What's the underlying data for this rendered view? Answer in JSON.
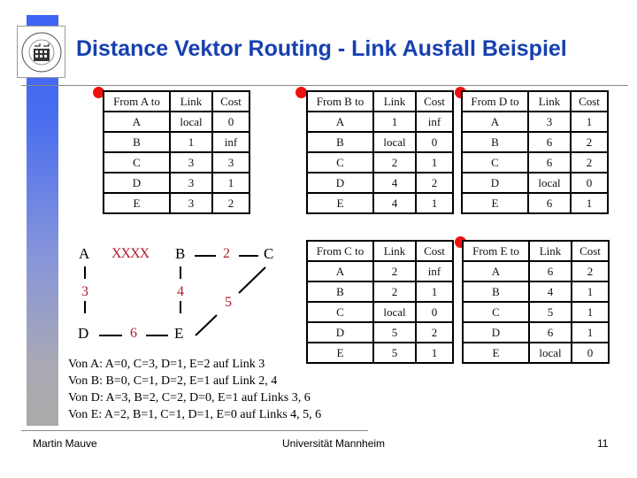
{
  "slide": {
    "title": "Distance Vektor Routing - Link Ausfall Beispiel",
    "logo": "university-seal-icon",
    "accent_color": "#1740b0",
    "bullet_color": "#ee1010",
    "label_color": "#b01c2e"
  },
  "tables": {
    "A": {
      "headers": [
        "From A to",
        "Link",
        "Cost"
      ],
      "rows": [
        [
          "A",
          "local",
          "0"
        ],
        [
          "B",
          "1",
          "inf"
        ],
        [
          "C",
          "3",
          "3"
        ],
        [
          "D",
          "3",
          "1"
        ],
        [
          "E",
          "3",
          "2"
        ]
      ]
    },
    "B": {
      "headers": [
        "From B to",
        "Link",
        "Cost"
      ],
      "rows": [
        [
          "A",
          "1",
          "inf"
        ],
        [
          "B",
          "local",
          "0"
        ],
        [
          "C",
          "2",
          "1"
        ],
        [
          "D",
          "4",
          "2"
        ],
        [
          "E",
          "4",
          "1"
        ]
      ]
    },
    "D": {
      "headers": [
        "From D to",
        "Link",
        "Cost"
      ],
      "rows": [
        [
          "A",
          "3",
          "1"
        ],
        [
          "B",
          "6",
          "2"
        ],
        [
          "C",
          "6",
          "2"
        ],
        [
          "D",
          "local",
          "0"
        ],
        [
          "E",
          "6",
          "1"
        ]
      ]
    },
    "C": {
      "headers": [
        "From C to",
        "Link",
        "Cost"
      ],
      "rows": [
        [
          "A",
          "2",
          "inf"
        ],
        [
          "B",
          "2",
          "1"
        ],
        [
          "C",
          "local",
          "0"
        ],
        [
          "D",
          "5",
          "2"
        ],
        [
          "E",
          "5",
          "1"
        ]
      ]
    },
    "E": {
      "headers": [
        "From E to",
        "Link",
        "Cost"
      ],
      "rows": [
        [
          "A",
          "6",
          "2"
        ],
        [
          "B",
          "4",
          "1"
        ],
        [
          "C",
          "5",
          "1"
        ],
        [
          "D",
          "6",
          "1"
        ],
        [
          "E",
          "local",
          "0"
        ]
      ]
    }
  },
  "graph": {
    "nodes": {
      "A": "A",
      "B": "B",
      "C": "C",
      "D": "D",
      "E": "E"
    },
    "links": {
      "l1_failed": "XXXX",
      "l2": "2",
      "l3": "3",
      "l4": "4",
      "l5": "5",
      "l6": "6"
    }
  },
  "notes": [
    "Von A: A=0, C=3, D=1, E=2 auf Link 3",
    "Von B: B=0, C=1, D=2, E=1 auf Link 2, 4",
    "Von D: A=3, B=2, C=2, D=0, E=1 auf Links 3, 6",
    "Von E: A=2, B=1, C=1, D=1, E=0 auf Links 4, 5, 6"
  ],
  "footer": {
    "author": "Martin Mauve",
    "institution": "Universität Mannheim",
    "page": "11"
  }
}
